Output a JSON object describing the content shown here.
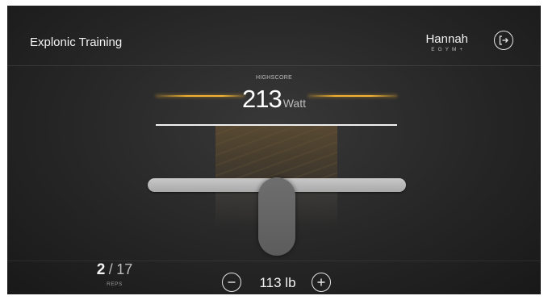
{
  "header": {
    "app_title": "Explonic Training",
    "user_name": "Hannah",
    "brand": "EGYM+",
    "logout_icon": "logout-icon"
  },
  "highscore": {
    "label": "HIGHSCORE",
    "value": "213",
    "unit": "Watt"
  },
  "reps": {
    "current": "2",
    "separator": "/",
    "total": "17",
    "label": "REPS"
  },
  "weight": {
    "value": "113 lb",
    "decrease_icon": "minus-icon",
    "increase_icon": "plus-icon"
  },
  "colors": {
    "accent": "#f0b030",
    "background": "#252525",
    "slider": "#b8b8b8",
    "handle": "#646464"
  }
}
